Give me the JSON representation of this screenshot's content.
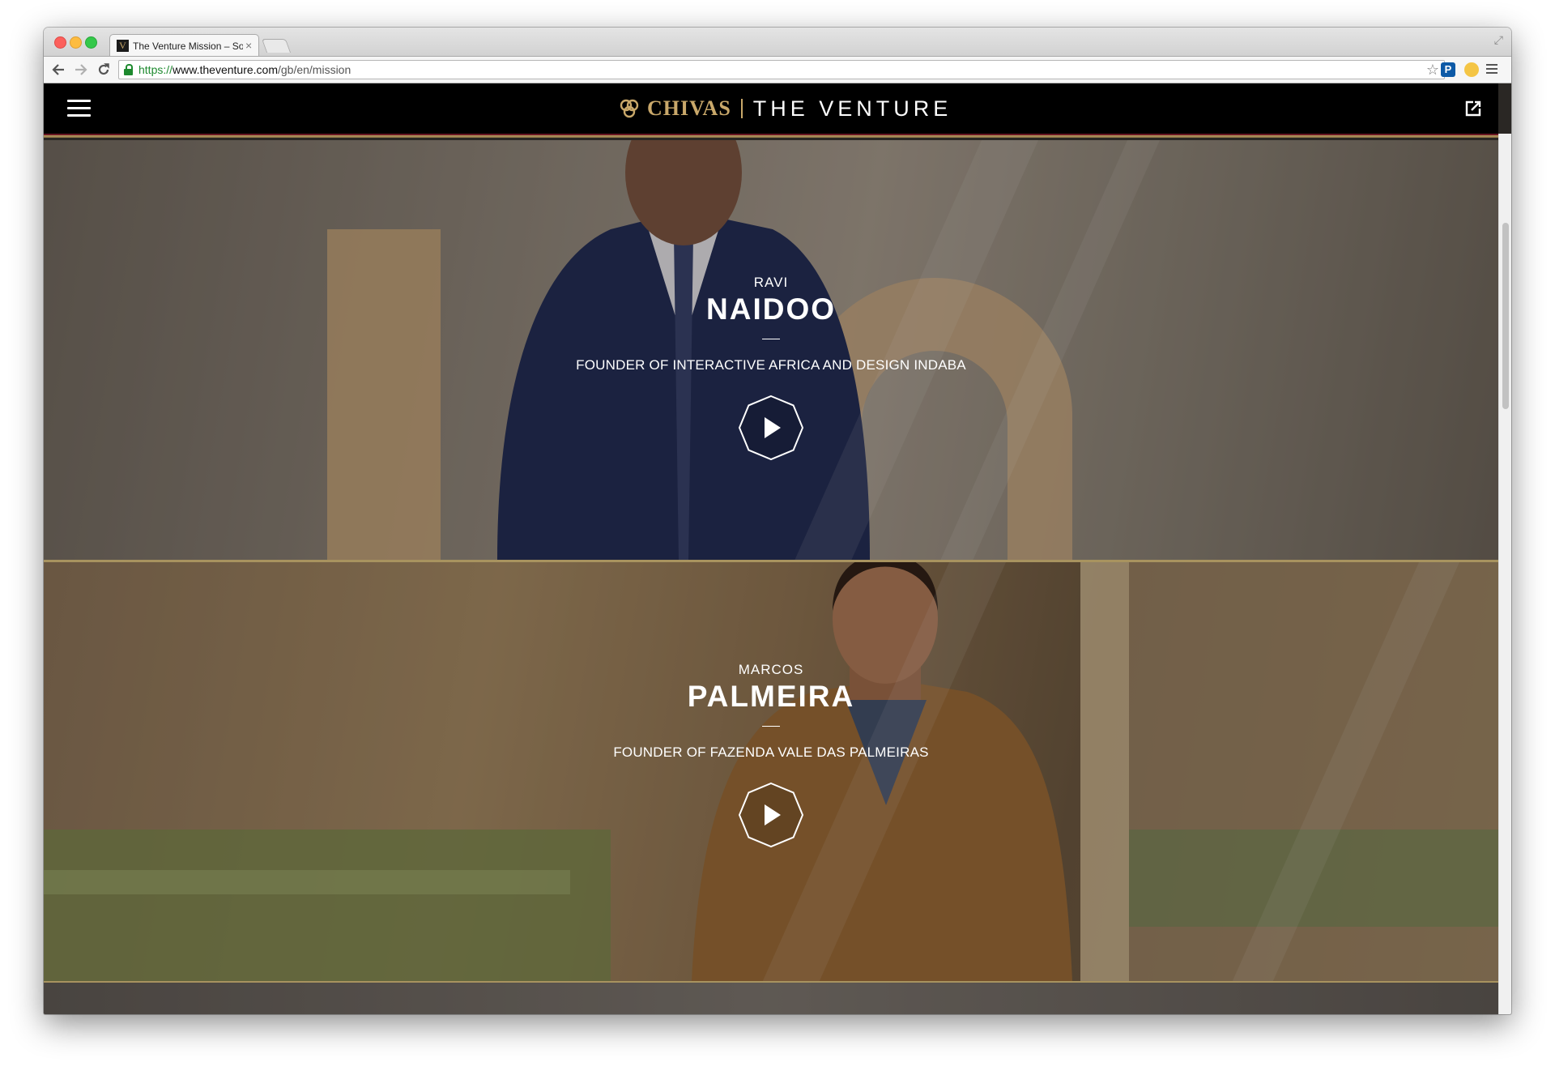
{
  "browser": {
    "tab_title": "The Venture Mission – Soc",
    "tab_close": "×",
    "url": {
      "scheme": "https://",
      "host": "www.theventure.com",
      "path": "/gb/en/mission"
    }
  },
  "site": {
    "brand_chivas": "CHIVAS",
    "brand_venture": "THE VENTURE"
  },
  "founders": [
    {
      "first_name": "RAVI",
      "last_name": "NAIDOO",
      "role": "FOUNDER OF INTERACTIVE AFRICA AND DESIGN INDABA"
    },
    {
      "first_name": "MARCOS",
      "last_name": "PALMEIRA",
      "role": "FOUNDER OF FAZENDA VALE DAS PALMEIRAS"
    }
  ],
  "icons": {
    "back": "arrow-left-icon",
    "forward": "arrow-right-icon",
    "reload": "reload-icon",
    "lock": "lock-icon",
    "star": "star-icon",
    "menu": "hamburger-icon",
    "share": "external-link-icon",
    "play": "play-icon"
  },
  "colors": {
    "brand_gold": "#c9a86a",
    "header_bg": "#000000",
    "accent_red": "#6a1622",
    "secure_green": "#1e8a2f"
  }
}
